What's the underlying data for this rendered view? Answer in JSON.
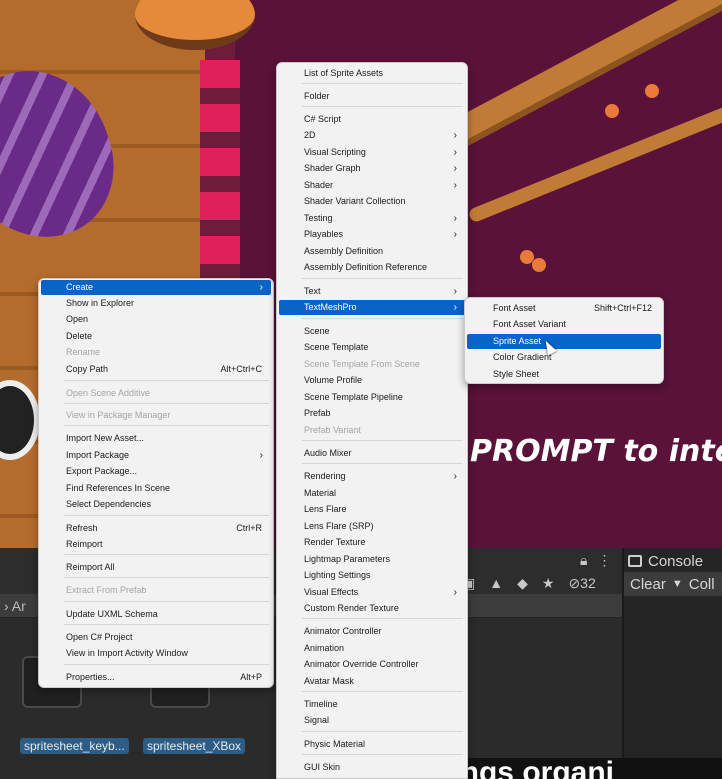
{
  "overlay_text": "PROMPT to inte",
  "subtitle_text": "things organi",
  "editor": {
    "console_tab": "Console",
    "console_clear": "Clear",
    "console_collapse": "Coll",
    "badge_count": "32",
    "breadcrumb": "Ar",
    "assets": [
      "spritesheet_keyb...",
      "spritesheet_XBox"
    ]
  },
  "context_menu": {
    "items": [
      {
        "label": "Create",
        "submenu": true,
        "highlighted": true
      },
      {
        "label": "Show in Explorer"
      },
      {
        "label": "Open"
      },
      {
        "label": "Delete"
      },
      {
        "label": "Rename",
        "disabled": true
      },
      {
        "label": "Copy Path",
        "shortcut": "Alt+Ctrl+C"
      },
      {
        "label": "Open Scene Additive",
        "disabled": true
      },
      {
        "label": "View in Package Manager",
        "disabled": true
      },
      {
        "label": "Import New Asset..."
      },
      {
        "label": "Import Package",
        "submenu": true
      },
      {
        "label": "Export Package..."
      },
      {
        "label": "Find References In Scene"
      },
      {
        "label": "Select Dependencies"
      },
      {
        "label": "Refresh",
        "shortcut": "Ctrl+R"
      },
      {
        "label": "Reimport"
      },
      {
        "label": "Reimport All"
      },
      {
        "label": "Extract From Prefab",
        "disabled": true
      },
      {
        "label": "Update UXML Schema"
      },
      {
        "label": "Open C# Project"
      },
      {
        "label": "View in Import Activity Window"
      },
      {
        "label": "Properties...",
        "shortcut": "Alt+P"
      }
    ]
  },
  "create_menu": {
    "items": [
      {
        "label": "List of Sprite Assets"
      },
      {
        "label": "Folder"
      },
      {
        "label": "C# Script"
      },
      {
        "label": "2D",
        "submenu": true
      },
      {
        "label": "Visual Scripting",
        "submenu": true
      },
      {
        "label": "Shader Graph",
        "submenu": true
      },
      {
        "label": "Shader",
        "submenu": true
      },
      {
        "label": "Shader Variant Collection"
      },
      {
        "label": "Testing",
        "submenu": true
      },
      {
        "label": "Playables",
        "submenu": true
      },
      {
        "label": "Assembly Definition"
      },
      {
        "label": "Assembly Definition Reference"
      },
      {
        "label": "Text",
        "submenu": true
      },
      {
        "label": "TextMeshPro",
        "submenu": true,
        "highlighted": true
      },
      {
        "label": "Scene"
      },
      {
        "label": "Scene Template"
      },
      {
        "label": "Scene Template From Scene",
        "disabled": true
      },
      {
        "label": "Volume Profile"
      },
      {
        "label": "Scene Template Pipeline"
      },
      {
        "label": "Prefab"
      },
      {
        "label": "Prefab Variant",
        "disabled": true
      },
      {
        "label": "Audio Mixer"
      },
      {
        "label": "Rendering",
        "submenu": true
      },
      {
        "label": "Material"
      },
      {
        "label": "Lens Flare"
      },
      {
        "label": "Lens Flare (SRP)"
      },
      {
        "label": "Render Texture"
      },
      {
        "label": "Lightmap Parameters"
      },
      {
        "label": "Lighting Settings"
      },
      {
        "label": "Visual Effects",
        "submenu": true
      },
      {
        "label": "Custom Render Texture"
      },
      {
        "label": "Animator Controller"
      },
      {
        "label": "Animation"
      },
      {
        "label": "Animator Override Controller"
      },
      {
        "label": "Avatar Mask"
      },
      {
        "label": "Timeline"
      },
      {
        "label": "Signal"
      },
      {
        "label": "Physic Material"
      },
      {
        "label": "GUI Skin"
      }
    ]
  },
  "textmeshpro_menu": {
    "items": [
      {
        "label": "Font Asset",
        "shortcut": "Shift+Ctrl+F12"
      },
      {
        "label": "Font Asset Variant"
      },
      {
        "label": "Sprite Asset",
        "highlighted": true
      },
      {
        "label": "Color Gradient"
      },
      {
        "label": "Style Sheet"
      }
    ]
  },
  "colors": {
    "menu_background": "#f2f2f2",
    "highlight": "#0a64c8",
    "scene_background": "#5a1238",
    "editor_background": "#383838"
  }
}
